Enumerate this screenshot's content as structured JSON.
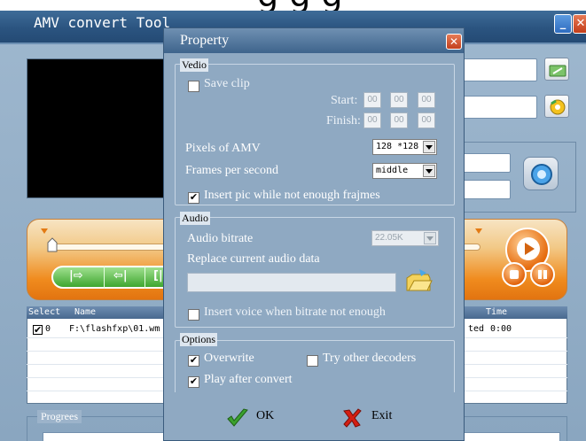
{
  "top_cut_text": "g   g g",
  "main": {
    "title": "AMV convert Tool",
    "list_headers": [
      "Select",
      "Name",
      "Time"
    ],
    "rows": [
      {
        "index": "0",
        "name": "F:\\flashfxp\\01.wm",
        "status": "ted",
        "time": "0:00"
      }
    ],
    "progress_label": "Progrees",
    "segment_labels": [
      "|⇨",
      "⇦|",
      "[|"
    ]
  },
  "dialog": {
    "title": "Property",
    "video": {
      "group_label": "Vedio",
      "save_clip": "Save clip",
      "start_label": "Start:",
      "finish_label": "Finish:",
      "time_placeholder": "00",
      "pixels_label": "Pixels of AMV",
      "pixels_value": "128 *128",
      "fps_label": "Frames per second",
      "fps_value": "middle",
      "insert_pic": "Insert pic while not enough frajmes"
    },
    "audio": {
      "group_label": "Audio",
      "bitrate_label": "Audio bitrate",
      "bitrate_value": "22.05K",
      "replace_label": "Replace current audio data",
      "insert_voice": "Insert voice when bitrate not enough"
    },
    "options": {
      "group_label": "Options",
      "overwrite": "Overwrite",
      "try_other": "Try other decoders",
      "play_after": "Play after convert"
    },
    "ok_label": "OK",
    "exit_label": "Exit"
  }
}
